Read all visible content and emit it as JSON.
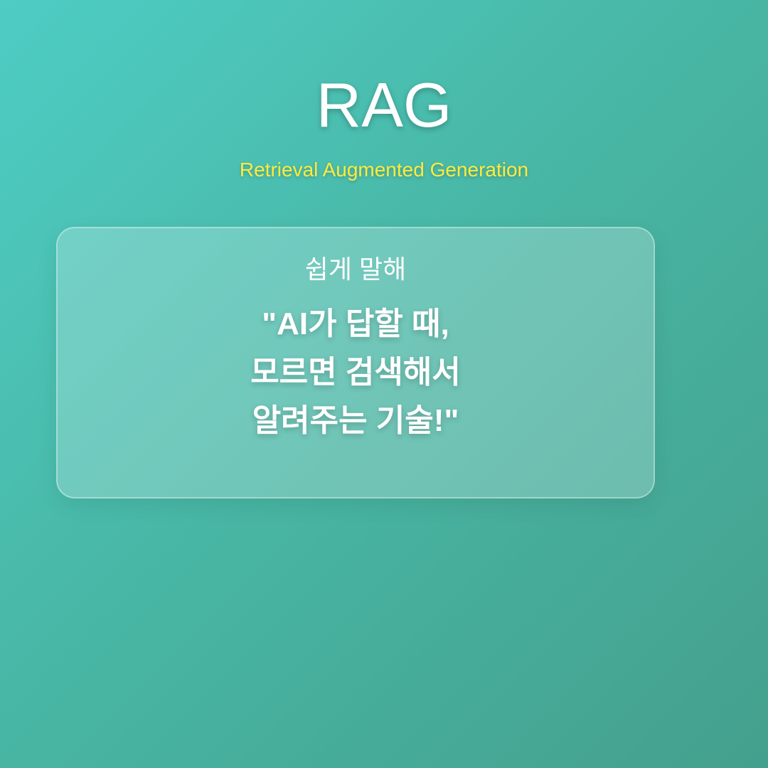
{
  "title": "RAG",
  "subtitle": "Retrieval Augmented Generation",
  "card": {
    "lead": "쉽게 말해",
    "lines": [
      "\"AI가 답할 때,",
      "모르면 검색해서",
      "알려주는 기술!\""
    ]
  },
  "colors": {
    "background_start": "#4ecdc4",
    "background_end": "#44a08d",
    "subtitle": "#ffeb3b",
    "text": "#ffffff"
  }
}
